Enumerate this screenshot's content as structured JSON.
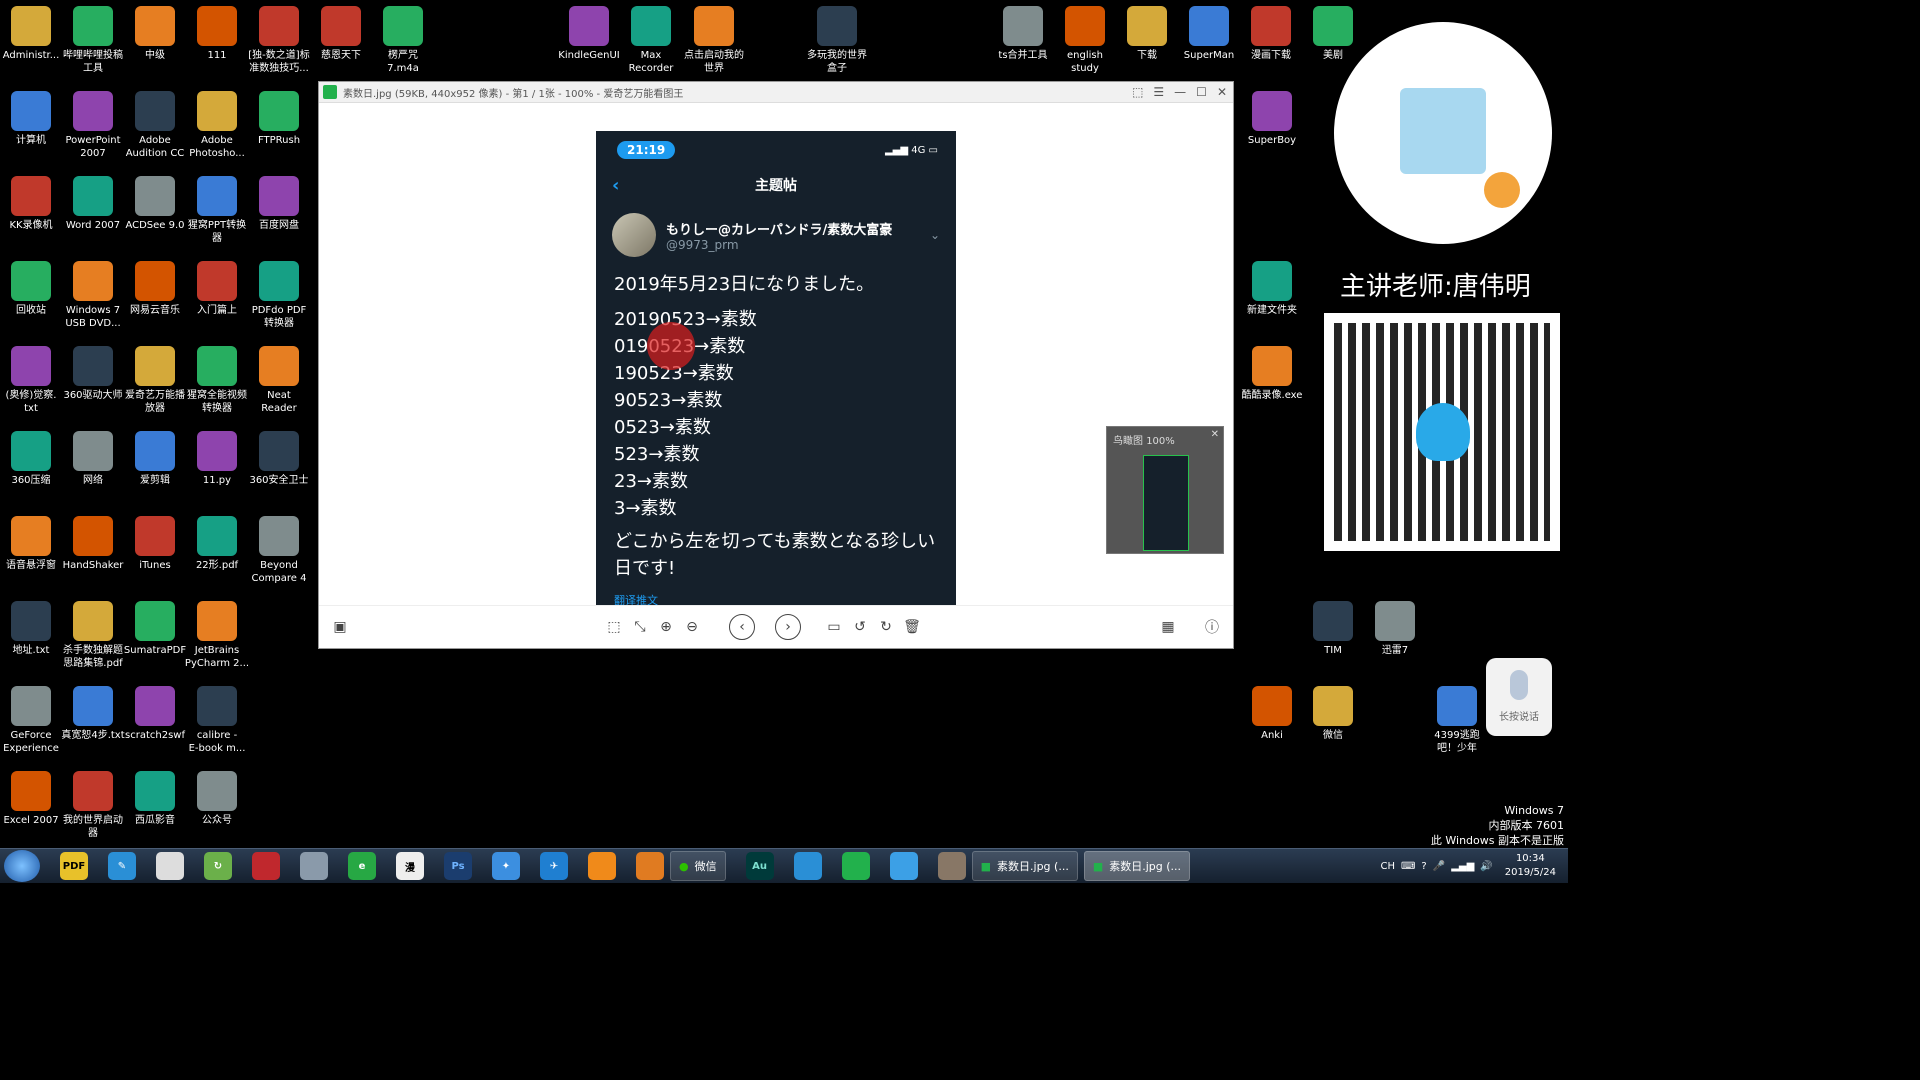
{
  "desktop": {
    "icons_left": [
      {
        "label": "Administr...",
        "x": 0
      },
      {
        "label": "哔哩哔哩投稿\n工具",
        "x": 1
      },
      {
        "label": "中级",
        "x": 2
      },
      {
        "label": "111",
        "x": 3
      },
      {
        "label": "[独-数之道]标\n准数独技巧...",
        "x": 4
      },
      {
        "label": "慈恩天下",
        "x": 5
      },
      {
        "label": "楞严咒\n7.m4a",
        "x": 6
      }
    ],
    "col1": [
      "Administr...",
      "计算机",
      "KK录像机",
      "回收站",
      "(奥修)觉察.\ntxt",
      "360压缩",
      "语音悬浮窗",
      "地址.txt",
      "GeForce\nExperience",
      "Excel 2007"
    ],
    "col2": [
      "哔哩哔哩投稿\n工具",
      "PowerPoint\n2007",
      "Word 2007",
      "Windows 7\nUSB DVD...",
      "360驱动大师",
      "网络",
      "HandShaker",
      "杀手数独解题\n思路集锦.pdf",
      "真宽恕4步.txt",
      "我的世界启动\n器"
    ],
    "col3": [
      "中级",
      "Adobe\nAudition CC",
      "ACDSee 9.0",
      "网易云音乐",
      "爱奇艺万能播\n放器",
      "爱剪辑",
      "iTunes",
      "SumatraPDF",
      "scratch2swf",
      "西瓜影音"
    ],
    "col4": [
      "111",
      "Adobe\nPhotosho...",
      "猩窝PPT转换\n器",
      "入门篇上",
      "猩窝全能视频\n转换器",
      "11.py",
      "22形.pdf",
      "JetBrains\nPyCharm 2...",
      "calibre -\nE-book m...",
      "公众号"
    ],
    "col5": [
      "[独-数之道]标\n准数独技巧...",
      "FTPRush",
      "百度网盘",
      "PDFdo PDF\n转换器",
      "Neat\nReader",
      "360安全卫士",
      "Beyond\nCompare 4"
    ],
    "top_row": [
      "慈恩天下",
      "楞严咒\n7.m4a",
      "KindleGenUI",
      "Max\nRecorder",
      "点击启动我的\n世界",
      "多玩我的世界\n盒子",
      "ts合并工具",
      "english\nstudy",
      "下载",
      "SuperMan",
      "漫画下载",
      "美剧"
    ],
    "right_col": [
      "SuperBoy",
      "新建文件夹",
      "酷酷录像.exe",
      "TIM",
      "迅雷7",
      "Anki",
      "微信",
      "4399逃跑\n吧！少年"
    ]
  },
  "viewer": {
    "title": "素数日.jpg (59KB, 440x952 像素) - 第1 / 1张 - 100% - 爱奇艺万能看图王",
    "overview_label": "鸟瞰图",
    "overview_zoom": "100%"
  },
  "phone": {
    "time": "21:19",
    "network": "4G",
    "nav_title": "主题帖",
    "author_name": "もりしー@カレーパンドラ/素数大富豪",
    "author_handle": "@9973_prm",
    "tweet_head": "2019年5月23日になりました。",
    "tweet_lines": [
      "20190523→素数",
      "0190523→素数",
      "190523→素数",
      "90523→素数",
      "0523→素数",
      "523→素数",
      "23→素数",
      "3→素数"
    ],
    "tweet_tail": "どこから左を切っても素数となる珍しい日です!",
    "translate": "翻译推文"
  },
  "promo": {
    "teacher": "主讲老师:唐伟明",
    "mic_label": "长按说话"
  },
  "watermark": {
    "line1": "Windows 7",
    "line2": "内部版本 7601",
    "line3": "此 Windows 副本不是正版"
  },
  "taskbar": {
    "wechat_task": "微信",
    "task1": "素数日.jpg (...",
    "task2": "素数日.jpg (...",
    "ime": "CH",
    "time": "10:34",
    "date": "2019/5/24"
  }
}
